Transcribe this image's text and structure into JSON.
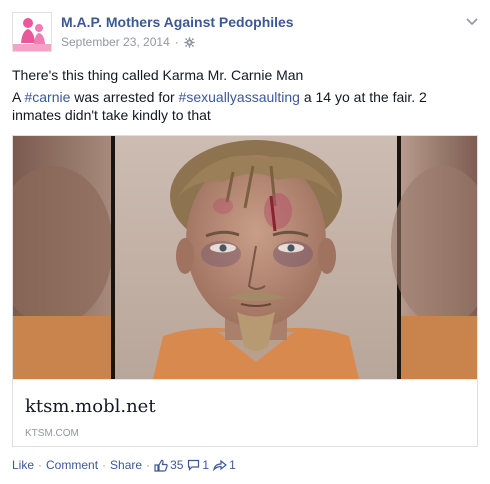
{
  "post": {
    "page_name": "M.A.P. Mothers Against Pedophiles",
    "date": "September 23, 2014",
    "separator": "·",
    "privacy_icon": "gear-icon",
    "menu_icon": "chevron-down-icon",
    "text_line1": "There's this thing called Karma Mr. Carnie Man",
    "text_line2": {
      "prefix": "A ",
      "hashtag1": "#carnie",
      "middle": " was arrested for ",
      "hashtag2": "#sexuallyassaulting",
      "suffix": " a 14 yo at the fair. 2 inmates didn't take kindly to that"
    }
  },
  "link_card": {
    "title": "ktsm.mobl.net",
    "domain": "KTSM.COM",
    "image": "mugshot-photo"
  },
  "actions": {
    "like": "Like",
    "comment": "Comment",
    "share": "Share",
    "dot": "·",
    "likes_count": "35",
    "comments_count": "1",
    "shares_count": "1",
    "like_icon": "thumbs-up-icon",
    "comment_icon": "comment-bubble-icon",
    "share_icon": "share-arrow-icon"
  },
  "colors": {
    "link_blue": "#3b5998",
    "meta_gray": "#9197a3",
    "text": "#141823",
    "logo_pink": "#e8589a"
  }
}
